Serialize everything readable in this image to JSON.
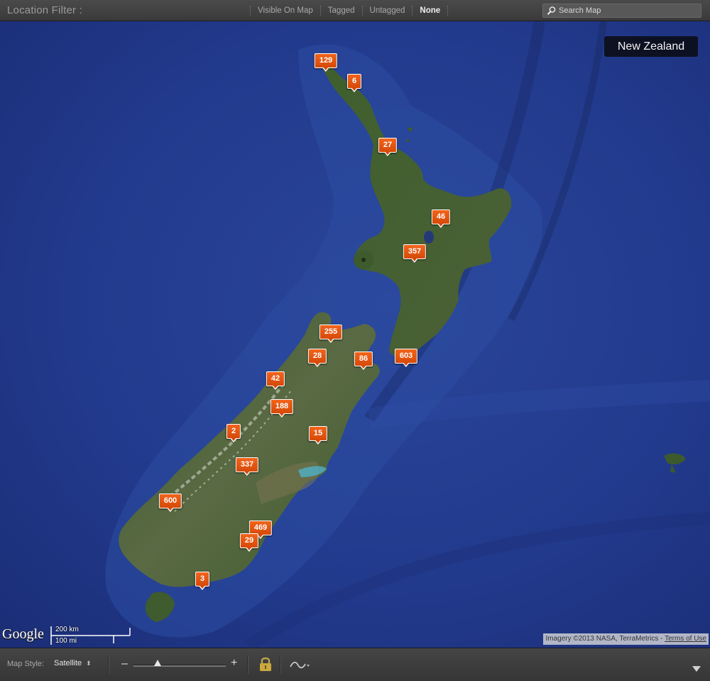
{
  "header": {
    "title": "Location Filter :",
    "filters": [
      {
        "label": "Visible On Map"
      },
      {
        "label": "Tagged"
      },
      {
        "label": "Untagged"
      },
      {
        "label": "None"
      }
    ],
    "active_filter": "None",
    "search_placeholder": "Search Map"
  },
  "map": {
    "region_label": "New Zealand",
    "markers": [
      {
        "count": "129"
      },
      {
        "count": "6"
      },
      {
        "count": "27"
      },
      {
        "count": "46"
      },
      {
        "count": "357"
      },
      {
        "count": "255"
      },
      {
        "count": "28"
      },
      {
        "count": "86"
      },
      {
        "count": "603"
      },
      {
        "count": "42"
      },
      {
        "count": "188"
      },
      {
        "count": "2"
      },
      {
        "count": "15"
      },
      {
        "count": "337"
      },
      {
        "count": "600"
      },
      {
        "count": "469"
      },
      {
        "count": "29"
      },
      {
        "count": "3"
      }
    ],
    "google_logo": "Google",
    "scale_km": "200 km",
    "scale_mi": "100 mi",
    "credits": "Imagery ©2013 NASA, TerraMetrics - ",
    "terms_link": "Terms of Use",
    "colors": {
      "ocean": "#1f3585",
      "land": "#3d5c2e",
      "marker": "#e8590f"
    }
  },
  "footer": {
    "map_style_label": "Map Style:",
    "map_style_value": "Satellite",
    "zoom_minus": "–",
    "zoom_plus": "+",
    "icons": [
      "lock-icon",
      "track-log-icon",
      "dropdown-arrow-icon"
    ]
  }
}
